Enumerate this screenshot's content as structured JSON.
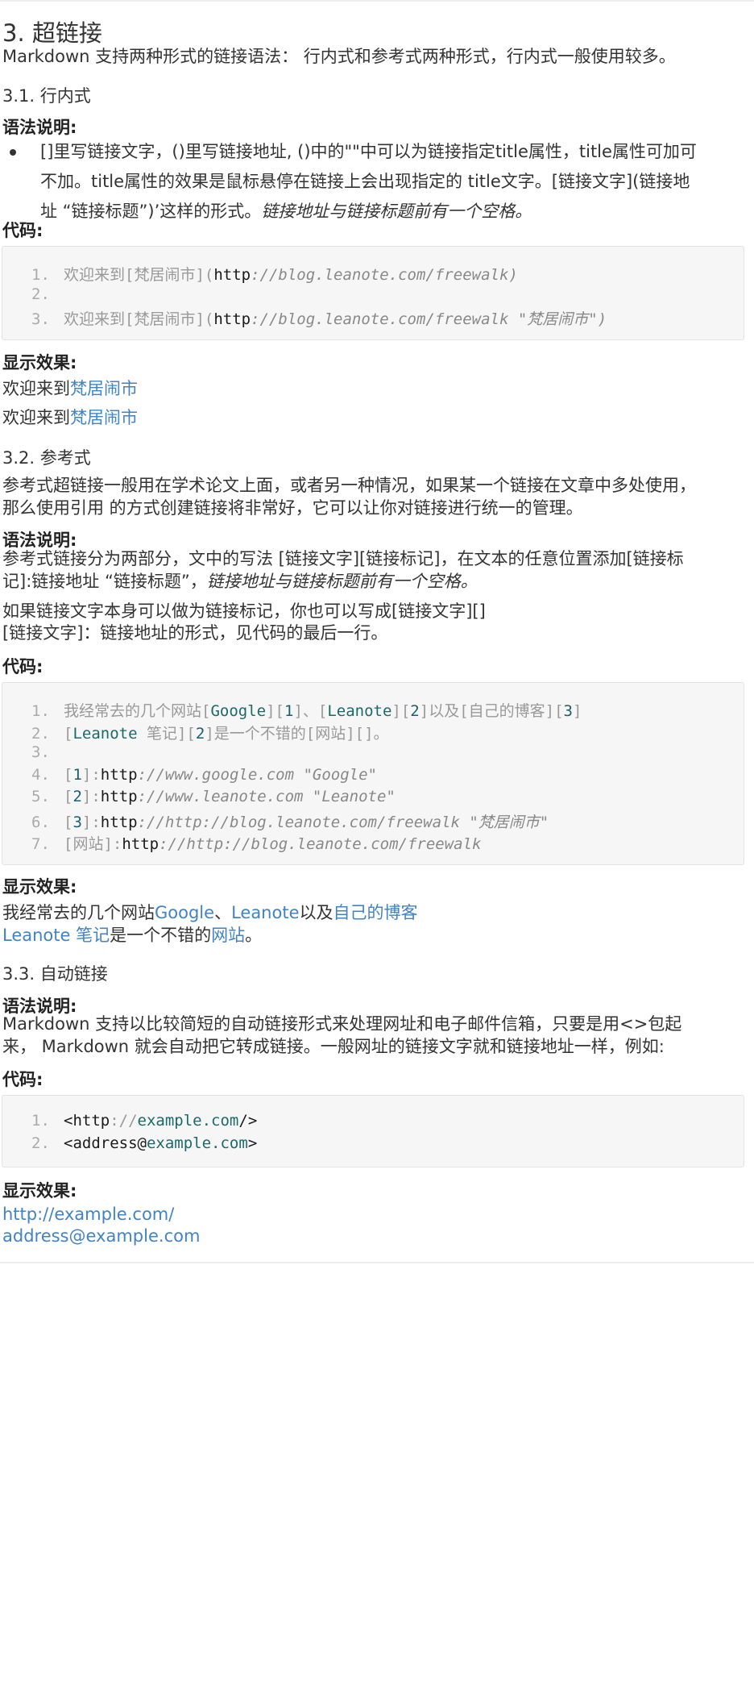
{
  "heading": "3. 超链接",
  "intro": "Markdown 支持两种形式的链接语法： 行内式和参考式两种形式，行内式一般使用较多。",
  "s1": {
    "heading": "3.1. 行内式",
    "syntax_label": "语法说明:",
    "bullet_l1": "[]里写链接文字，()里写链接地址, ()中的\"\"中可以为链接指定title属性，title属性可加可",
    "bullet_l2": "不加。title属性的效果是鼠标悬停在链接上会出现指定的 title文字。[链接文字](链接地",
    "bullet_l3_a": "址 “链接标题”)’这样的形式。",
    "bullet_l3_b": "链接地址与链接标题前有一个空格。",
    "code_label": "代码:",
    "code": [
      {
        "n": "1.",
        "a": "欢迎来到[梵居闹市](",
        "b": "http",
        "c": "://blog.leanote.com/freewalk)"
      },
      {
        "n": "2.",
        "a": "",
        "b": "",
        "c": ""
      },
      {
        "n": "3.",
        "a": "欢迎来到[梵居闹市](",
        "b": "http",
        "c": "://blog.leanote.com/freewalk \"梵居闹市\")"
      }
    ],
    "result_label": "显示效果:",
    "result1_text": "欢迎来到",
    "result1_link": "梵居闹市",
    "result2_text": "欢迎来到",
    "result2_link": "梵居闹市"
  },
  "s2": {
    "heading": "3.2. 参考式",
    "p1_l1": "参考式超链接一般用在学术论文上面，或者另一种情况，如果某一个链接在文章中多处使用，",
    "p1_l2": "那么使用引用 的方式创建链接将非常好，它可以让你对链接进行统一的管理。",
    "syntax_label": "语法说明:",
    "p2_l1": "参考式链接分为两部分，文中的写法 [链接文字][链接标记]，在文本的任意位置添加[链接标",
    "p2_l2_a": "记]:链接地址 “链接标题”，",
    "p2_l2_b": "链接地址与链接标题前有一个空格。",
    "p3_l1": "如果链接文字本身可以做为链接标记，你也可以写成[链接文字][]",
    "p3_l2": "[链接文字]：链接地址的形式，见代码的最后一行。",
    "code_label": "代码:",
    "code": [
      {
        "n": "1.",
        "p1": "我经常去的几个网站[",
        "k1": "Google",
        "p2": "][",
        "k2": "1",
        "p3": "]、[",
        "k3": "Leanote",
        "p4": "][",
        "k4": "2",
        "p5": "]以及[自己的博客][",
        "k5": "3",
        "p6": "]"
      },
      {
        "n": "2.",
        "p1": "[",
        "k1": "Leanote",
        "p2": " 笔记][",
        "k2": "2",
        "p3": "]是一个不错的[网站][]。"
      },
      {
        "n": "3."
      },
      {
        "n": "4.",
        "p1": "[",
        "k1": "1",
        "p2": "]:",
        "h": "http",
        "i": "://www.google.com \"Google\""
      },
      {
        "n": "5.",
        "p1": "[",
        "k1": "2",
        "p2": "]:",
        "h": "http",
        "i": "://www.leanote.com \"Leanote\""
      },
      {
        "n": "6.",
        "p1": "[",
        "k1": "3",
        "p2": "]:",
        "h": "http",
        "i": "://http://blog.leanote.com/freewalk \"梵居闹市\""
      },
      {
        "n": "7.",
        "p1": "[网站]:",
        "h": "http",
        "i": "://http://blog.leanote.com/freewalk"
      }
    ],
    "result_label": "显示效果:",
    "r1_a": "我经常去的几个网站",
    "r1_l1": "Google",
    "r1_b": "、",
    "r1_l2": "Leanote",
    "r1_c": "以及",
    "r1_l3": "自己的博客",
    "r2_l1": "Leanote 笔记",
    "r2_a": "是一个不错的",
    "r2_l2": "网站",
    "r2_b": "。"
  },
  "s3": {
    "heading": "3.3. 自动链接",
    "syntax_label": "语法说明:",
    "p_l1": "Markdown 支持以比较简短的自动链接形式来处理网址和电子邮件信箱，只要是用<>包起",
    "p_l2": "来， Markdown 就会自动把它转成链接。一般网址的链接文字就和链接地址一样，例如:",
    "code_label": "代码:",
    "code": [
      {
        "n": "1.",
        "a": "<",
        "b": "http",
        "c": "://",
        "d": "example.com",
        "e": "/>"
      },
      {
        "n": "2.",
        "a": "<",
        "b": "address@",
        "d": "example.com",
        "e": ">"
      }
    ],
    "result_label": "显示效果:",
    "link1": "http://example.com/",
    "link2": "address@example.com"
  }
}
